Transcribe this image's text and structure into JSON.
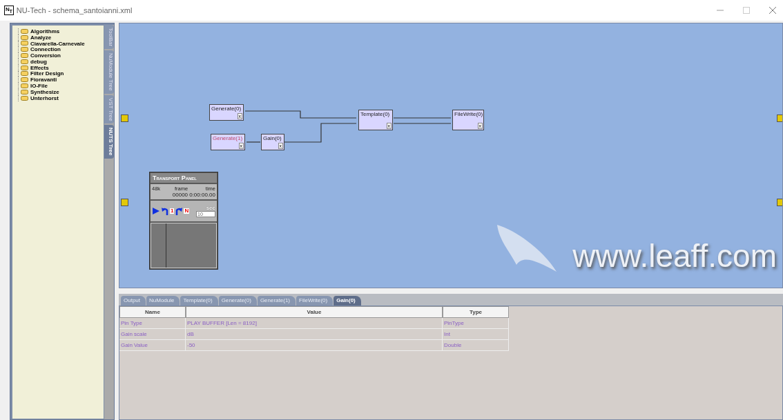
{
  "window": {
    "title": "NU-Tech - schema_santoianni.xml",
    "logo": "N",
    "logo_sub": "T"
  },
  "tree": {
    "items": [
      {
        "label": "Algorithms"
      },
      {
        "label": "Analyze"
      },
      {
        "label": "Ciavarella-Carnevale"
      },
      {
        "label": "Connection"
      },
      {
        "label": "Conversion"
      },
      {
        "label": "debug"
      },
      {
        "label": "Effects"
      },
      {
        "label": "Filter Design"
      },
      {
        "label": "Fioravanti"
      },
      {
        "label": "IO-File"
      },
      {
        "label": "Synthesize"
      },
      {
        "label": "Unterhorst"
      }
    ]
  },
  "side_tabs": [
    {
      "label": "ToolBar",
      "selected": false
    },
    {
      "label": "NuModule Tree",
      "selected": false
    },
    {
      "label": "VST Tree",
      "selected": false
    },
    {
      "label": "NUTS Tree",
      "selected": true
    }
  ],
  "canvas": {
    "nodes": [
      {
        "label": "Generate(0)",
        "inactive": false,
        "close": "x"
      },
      {
        "label": "Generate(1)",
        "inactive": true,
        "close": "x"
      },
      {
        "label": "Gain(0)",
        "inactive": false,
        "close": "x"
      },
      {
        "label": "Template(0)",
        "inactive": false,
        "close": "x"
      },
      {
        "label": "FileWrite(0)",
        "inactive": false,
        "close": "x"
      }
    ],
    "transport_panel": {
      "title": "Transport Panel",
      "rate": "48k",
      "frame_label": "frame",
      "frame": "00000",
      "time_label": "time",
      "time": "0:00:00.00",
      "sec_label": "sec",
      "sec": "10",
      "step_one": "1",
      "step_n": "N"
    },
    "logo": "www.leaff.com"
  },
  "bottom_tabs": [
    {
      "label": "Output",
      "selected": false
    },
    {
      "label": "NuModule",
      "selected": false
    },
    {
      "label": "Template(0)",
      "selected": false
    },
    {
      "label": "Generate(0)",
      "selected": false
    },
    {
      "label": "Generate(1)",
      "selected": false
    },
    {
      "label": "FileWrite(0)",
      "selected": false
    },
    {
      "label": "Gain(0)",
      "selected": true
    }
  ],
  "table": {
    "columns": [
      "Name",
      "Value",
      "Type"
    ],
    "rows": [
      [
        "Pin Type",
        "PLAY BUFFER [Len = 8192]",
        "PinType"
      ],
      [
        "Gain scale",
        "dB",
        "Int"
      ],
      [
        "Gain Value",
        "-50",
        "Double"
      ]
    ]
  }
}
